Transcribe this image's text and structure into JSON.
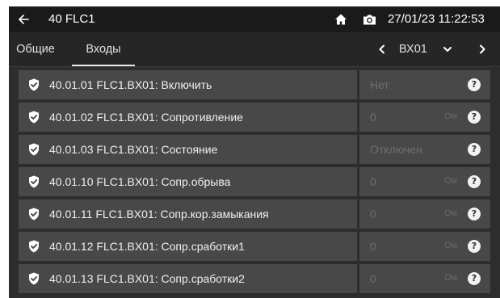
{
  "header": {
    "title": "40 FLC1",
    "datetime": "27/01/23 11:22:53",
    "icons": {
      "back": "arrow-left-icon",
      "home": "home-icon",
      "camera": "camera-icon"
    }
  },
  "tabs": [
    {
      "label": "Общие",
      "active": false
    },
    {
      "label": "Входы",
      "active": true
    }
  ],
  "selector": {
    "value": "ВХ01",
    "prev_icon": "chevron-left-icon",
    "next_icon": "chevron-right-icon",
    "dropdown_icon": "chevron-down-icon"
  },
  "colors": {
    "background": "#2d2d2d",
    "row": "#484848",
    "header": "#1a1a1a",
    "text": "#f0f0f0",
    "muted": "#6e6e6e"
  },
  "rows": [
    {
      "label": "40.01.01 FLC1.BX01: Включить",
      "value": "Нет",
      "unit": ""
    },
    {
      "label": "40.01.02 FLC1.BX01: Сопротивление",
      "value": "0",
      "unit": "Ом"
    },
    {
      "label": "40.01.03 FLC1.BX01: Состояние",
      "value": "Отключен",
      "unit": ""
    },
    {
      "label": "40.01.10 FLC1.BX01: Сопр.обрыва",
      "value": "0",
      "unit": "Ом"
    },
    {
      "label": "40.01.11 FLC1.BX01: Сопр.кор.замыкания",
      "value": "0",
      "unit": "Ом"
    },
    {
      "label": "40.01.12 FLC1.BX01: Сопр.сработки1",
      "value": "0",
      "unit": "Ом"
    },
    {
      "label": "40.01.13 FLC1.BX01: Сопр.сработки2",
      "value": "0",
      "unit": "Ом"
    }
  ],
  "help_glyph": "?"
}
